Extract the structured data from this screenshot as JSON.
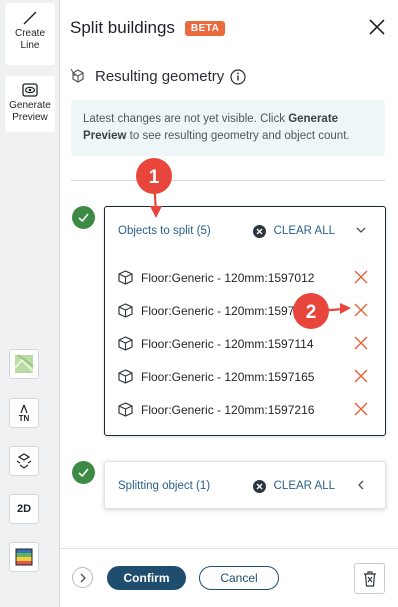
{
  "rail": {
    "create_line": "Create Line",
    "generate_preview": "Generate Preview",
    "tools": [
      "satellite-map-icon",
      "north-arrow-icon",
      "layers-icon",
      "2D",
      "color-layers-icon"
    ],
    "tn_label": "TN",
    "twod_label": "2D"
  },
  "panel": {
    "title": "Split buildings",
    "beta": "BETA",
    "geometry_title": "Resulting geometry",
    "notice_pre": "Latest changes are not yet visible. Click ",
    "notice_bold": "Generate Preview",
    "notice_post": " to see resulting geometry and object count."
  },
  "objects_card": {
    "title": "Objects to split (5)",
    "clear_all": "CLEAR ALL",
    "items": [
      "Floor:Generic - 120mm:1597012",
      "Floor:Generic - 120mm:1597",
      "Floor:Generic - 120mm:1597114",
      "Floor:Generic - 120mm:1597165",
      "Floor:Generic - 120mm:1597216"
    ]
  },
  "splitting_card": {
    "title": "Splitting object (1)",
    "clear_all": "CLEAR ALL"
  },
  "callouts": {
    "one": "1",
    "two": "2"
  },
  "footer": {
    "confirm": "Confirm",
    "cancel": "Cancel"
  },
  "colors": {
    "accent": "#1f4d6e",
    "beta": "#ea6a3d",
    "success": "#3d8a45",
    "remove": "#e2623b",
    "callout": "#e8453c"
  }
}
